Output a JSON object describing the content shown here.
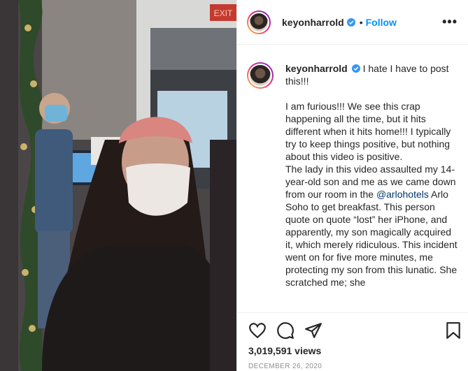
{
  "post": {
    "username": "keyonharrold",
    "follow_label": "Follow",
    "separator": "•",
    "more_label": "•••",
    "caption_first_line": "I hate I have to post this!!!",
    "caption_part1": "I am furious!!! We see this crap happening all the time, but it hits different when it hits home!!! I typically try to keep things positive, but nothing about this video is positive.\nThe lady in this video assaulted my 14-year-old son and me as we came down from our room in the ",
    "caption_mention": "@arlohotels",
    "caption_part2": " Arlo Soho to get breakfast. This person quote on quote “lost” her iPhone, and apparently, my son magically acquired it, which merely ridiculous. This incident went on for five more minutes, me protecting my son from this lunatic. She scratched me; she",
    "views": "3,019,591 views",
    "date": "DECEMBER 26, 2020"
  },
  "media": {
    "exit_sign": "EXIT"
  },
  "icons": {
    "like": "heart-icon",
    "comment": "comment-icon",
    "share": "share-icon",
    "save": "bookmark-icon"
  },
  "colors": {
    "link_blue": "#0095f6",
    "mention": "#00376b",
    "verified": "#3897f0"
  }
}
